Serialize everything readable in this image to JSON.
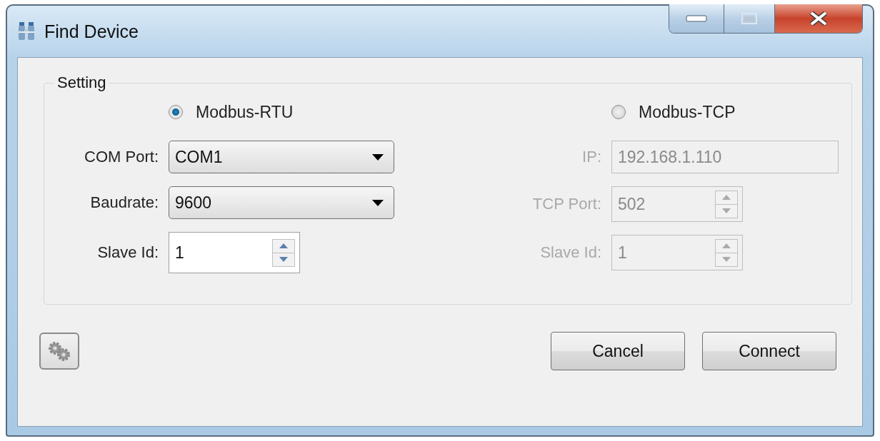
{
  "window": {
    "title": "Find Device"
  },
  "group": {
    "title": "Setting",
    "modes": [
      {
        "label": "Modbus-RTU",
        "selected": true,
        "fields": [
          {
            "label": "COM Port:",
            "kind": "dropdown",
            "value": "COM1",
            "disabled": false
          },
          {
            "label": "Baudrate:",
            "kind": "dropdown",
            "value": "9600",
            "disabled": false
          },
          {
            "label": "Slave Id:",
            "kind": "spinner",
            "value": "1",
            "disabled": false
          }
        ]
      },
      {
        "label": "Modbus-TCP",
        "selected": false,
        "fields": [
          {
            "label": "IP:",
            "kind": "text",
            "value": "192.168.1.110",
            "disabled": true
          },
          {
            "label": "TCP Port:",
            "kind": "spinner",
            "value": "502",
            "disabled": true
          },
          {
            "label": "Slave Id:",
            "kind": "spinner",
            "value": "1",
            "disabled": true
          }
        ]
      }
    ]
  },
  "buttons": [
    {
      "kind": "settings"
    },
    {
      "kind": "text",
      "label": "Cancel"
    },
    {
      "kind": "text",
      "label": "Connect"
    }
  ]
}
